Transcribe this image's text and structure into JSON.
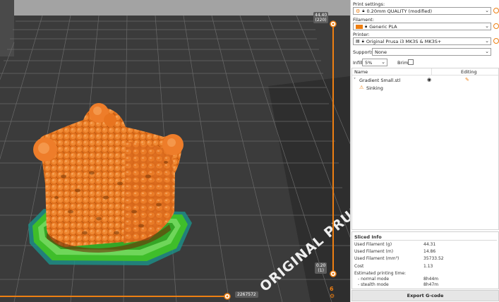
{
  "viewport": {
    "top_slider": {
      "value": "44.40",
      "layer": "(220)"
    },
    "bottom_slider": {
      "value": "0.20",
      "layer": "(1)"
    },
    "horizontal_slider": {
      "value": "2267572"
    },
    "bed_text": "ORIGINAL PRUS",
    "colors": {
      "model": "#e8741f",
      "support_brim": "#3fbe2a",
      "bed": "#3c3c3c",
      "accent": "#ee7f12"
    }
  },
  "panel": {
    "print_settings": {
      "label": "Print settings:",
      "value": "0.20mm QUALITY (modified)"
    },
    "filament": {
      "label": "Filament:",
      "value": "Generic PLA",
      "swatch_color": "#ee7f12"
    },
    "printer": {
      "label": "Printer:",
      "value": "Original Prusa i3 MK3S & MK3S+"
    },
    "supports": {
      "label": "Supports:",
      "value": "None"
    },
    "infill": {
      "label": "Infill:",
      "value": "5%"
    },
    "brim": {
      "label": "Brim:",
      "checked": false
    },
    "object_list": {
      "col_name": "Name",
      "col_editing": "Editing",
      "items": [
        {
          "name": "Gradient Small.stl"
        },
        {
          "name": "Sinking"
        }
      ]
    },
    "sliced_info": {
      "title": "Sliced Info",
      "rows": [
        {
          "label": "Used Filament (g)",
          "value": "44.31"
        },
        {
          "label": "Used Filament (m)",
          "value": "14.86"
        },
        {
          "label": "Used Filament (mm³)",
          "value": "35733.52"
        },
        {
          "label": "Cost",
          "value": "1.13"
        }
      ],
      "time_title": "Estimated printing time:",
      "normal_label": "- normal mode",
      "normal_value": "8h44m",
      "stealth_label": "- stealth mode",
      "stealth_value": "8h47m"
    },
    "export_label": "Export G-code"
  }
}
